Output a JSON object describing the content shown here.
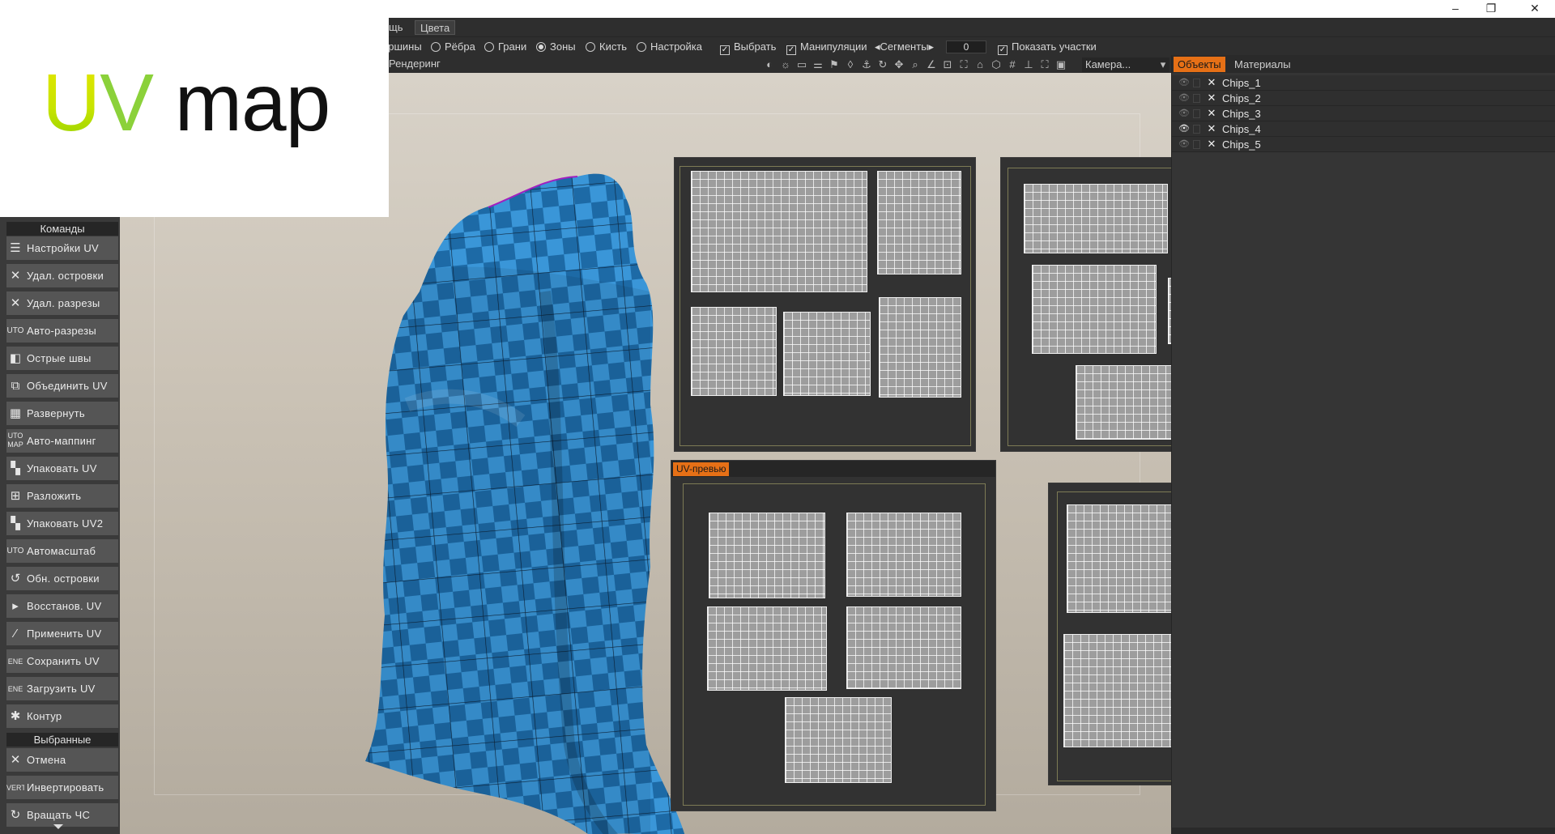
{
  "overlay": {
    "title_u": "U",
    "title_v": "V",
    "title_rest": " map"
  },
  "window": {
    "minimize": "–",
    "restore": "❐",
    "close": "✕"
  },
  "menubar": {
    "partial_item": "щь",
    "colors": "Цвета"
  },
  "modes": {
    "vertices": "ершины",
    "edges": "Рёбра",
    "faces": "Грани",
    "zones": "Зоны",
    "brush": "Кисть",
    "settings": "Настройка",
    "select": "Выбрать",
    "manipulators": "Манипуляции",
    "segments": "Сегменты",
    "segments_value": "0",
    "show_areas": "Показать  участки",
    "selected_mode": "zones"
  },
  "toolbar": {
    "render_label": "Рендеринг",
    "camera": "Камера..."
  },
  "right_panel": {
    "tabs": [
      {
        "label": "Объекты",
        "active": true
      },
      {
        "label": "Материалы",
        "active": false
      }
    ],
    "objects": [
      {
        "name": "Chips_1",
        "visible": false
      },
      {
        "name": "Chips_2",
        "visible": false
      },
      {
        "name": "Chips_3",
        "visible": false
      },
      {
        "name": "Chips_4",
        "visible": true
      },
      {
        "name": "Chips_5",
        "visible": false
      }
    ]
  },
  "left_panel": {
    "commands_header": "Команды",
    "commands": [
      {
        "label": "Настройки UV",
        "icon": "sliders-icon"
      },
      {
        "label": "Удал. островки",
        "icon": "x-icon"
      },
      {
        "label": "Удал. разрезы",
        "icon": "x-icon"
      },
      {
        "label": "Авто-разрезы",
        "icon": "auto-icon"
      },
      {
        "label": "Острые швы",
        "icon": "cube-icon"
      },
      {
        "label": "Объединить UV",
        "icon": "merge-icon"
      },
      {
        "label": "Развернуть",
        "icon": "unwrap-icon"
      },
      {
        "label": "Авто-маппинг",
        "icon": "automap-icon"
      },
      {
        "label": "Упаковать UV",
        "icon": "pack-icon"
      },
      {
        "label": "Разложить",
        "icon": "layout-icon"
      },
      {
        "label": "Упаковать UV2",
        "icon": "pack2-icon"
      },
      {
        "label": "Автомасштаб",
        "icon": "autoscale-icon"
      },
      {
        "label": "Обн. островки",
        "icon": "refresh-icon"
      },
      {
        "label": "Восстанов. UV",
        "icon": "restore-icon"
      },
      {
        "label": "Применить UV",
        "icon": "apply-icon"
      },
      {
        "label": "Сохранить UV",
        "icon": "save-icon"
      },
      {
        "label": "Загрузить UV",
        "icon": "load-icon"
      },
      {
        "label": "Контур",
        "icon": "contour-icon"
      }
    ],
    "selected_header": "Выбранные",
    "selected_commands": [
      {
        "label": "Отмена",
        "icon": "x-icon"
      },
      {
        "label": "Инвертировать",
        "icon": "invert-icon"
      },
      {
        "label": "Вращать ЧС",
        "icon": "rotate-cw-icon"
      }
    ]
  },
  "uv_preview": {
    "tab": "UV-превью"
  },
  "colors": {
    "accent": "#e67016",
    "sack": "#2e86c8",
    "island": "#9d9d9d"
  }
}
